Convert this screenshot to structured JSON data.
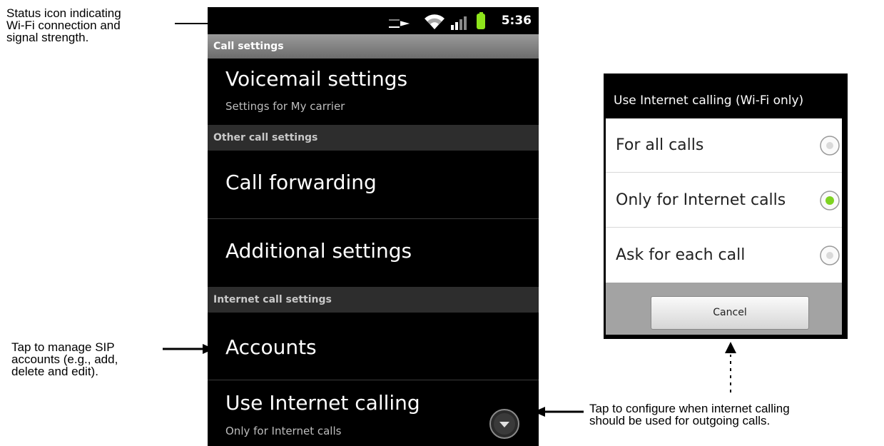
{
  "callouts": {
    "status": "Status icon indicating\nWi-Fi connection and\nsignal strength.",
    "accounts": "Tap to manage SIP\naccounts (e.g., add,\ndelete and edit).",
    "internet_calling": "Tap to configure when internet calling\nshould be used for outgoing calls."
  },
  "status_bar": {
    "time": "5:36",
    "icons": [
      "wifi-icon",
      "signal-icon",
      "battery-icon"
    ],
    "battery_color": "#8ee51b"
  },
  "settings": {
    "header": "Call settings",
    "voicemail": {
      "title": "Voicemail settings",
      "summary": "Settings for My carrier"
    },
    "other_header": "Other call settings",
    "call_forwarding": "Call forwarding",
    "additional": "Additional settings",
    "internet_header": "Internet call settings",
    "accounts": "Accounts",
    "use_internet": {
      "title": "Use Internet calling",
      "summary": "Only for Internet calls"
    }
  },
  "dialog": {
    "title": "Use Internet calling (Wi-Fi only)",
    "options": [
      {
        "label": "For all calls",
        "selected": false
      },
      {
        "label": "Only for Internet calls",
        "selected": true
      },
      {
        "label": "Ask for each call",
        "selected": false
      }
    ],
    "cancel": "Cancel",
    "selected_color": "#7ed321"
  }
}
